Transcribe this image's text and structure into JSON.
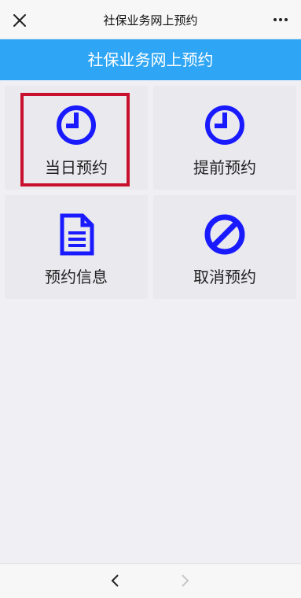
{
  "topbar": {
    "title": "社保业务网上预约",
    "close_icon": "close-icon",
    "more_icon": "more-icon"
  },
  "banner": {
    "title": "社保业务网上预约",
    "color": "#2fa6f5"
  },
  "tiles": [
    {
      "label": "当日预约",
      "icon": "clock-icon",
      "highlighted": true
    },
    {
      "label": "提前预约",
      "icon": "clock-icon"
    },
    {
      "label": "预约信息",
      "icon": "document-icon"
    },
    {
      "label": "取消预约",
      "icon": "ban-icon"
    }
  ],
  "colors": {
    "icon": "#1a1aff",
    "highlight": "#c8102e"
  },
  "bottombar": {
    "back_icon": "chevron-left-icon",
    "forward_icon": "chevron-right-icon"
  }
}
